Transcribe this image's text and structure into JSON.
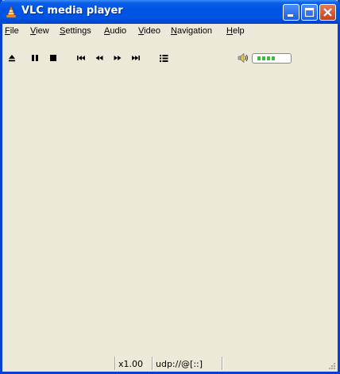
{
  "window": {
    "title": "VLC media player",
    "title_icon": "vlc-cone-icon",
    "controls": [
      "minimize-icon",
      "maximize-icon",
      "close-icon"
    ]
  },
  "menubar": {
    "items": [
      {
        "ul": "F",
        "rest": "ile"
      },
      {
        "ul": "V",
        "rest": "iew"
      },
      {
        "ul": "S",
        "rest": "ettings"
      },
      {
        "ul": "A",
        "rest": "udio"
      },
      {
        "ul": "V",
        "rest": "ideo"
      },
      {
        "ul": "N",
        "rest": "avigation"
      },
      {
        "ul": "H",
        "rest": "elp"
      }
    ]
  },
  "toolbar": {
    "buttons": [
      "eject-icon",
      "pause-icon",
      "stop-icon",
      "previous-icon",
      "rewind-icon",
      "fast-forward-icon",
      "next-icon",
      "playlist-icon"
    ],
    "volume_icon": "speaker-icon",
    "volume_level": 0.5
  },
  "statusbar": {
    "speed": "x1.00",
    "stream": "udp://@[::]"
  },
  "colors": {
    "titlebar": "#0054e3",
    "frame": "#0841d0",
    "face": "#ece9d8",
    "volume_fill": "#31c431"
  }
}
